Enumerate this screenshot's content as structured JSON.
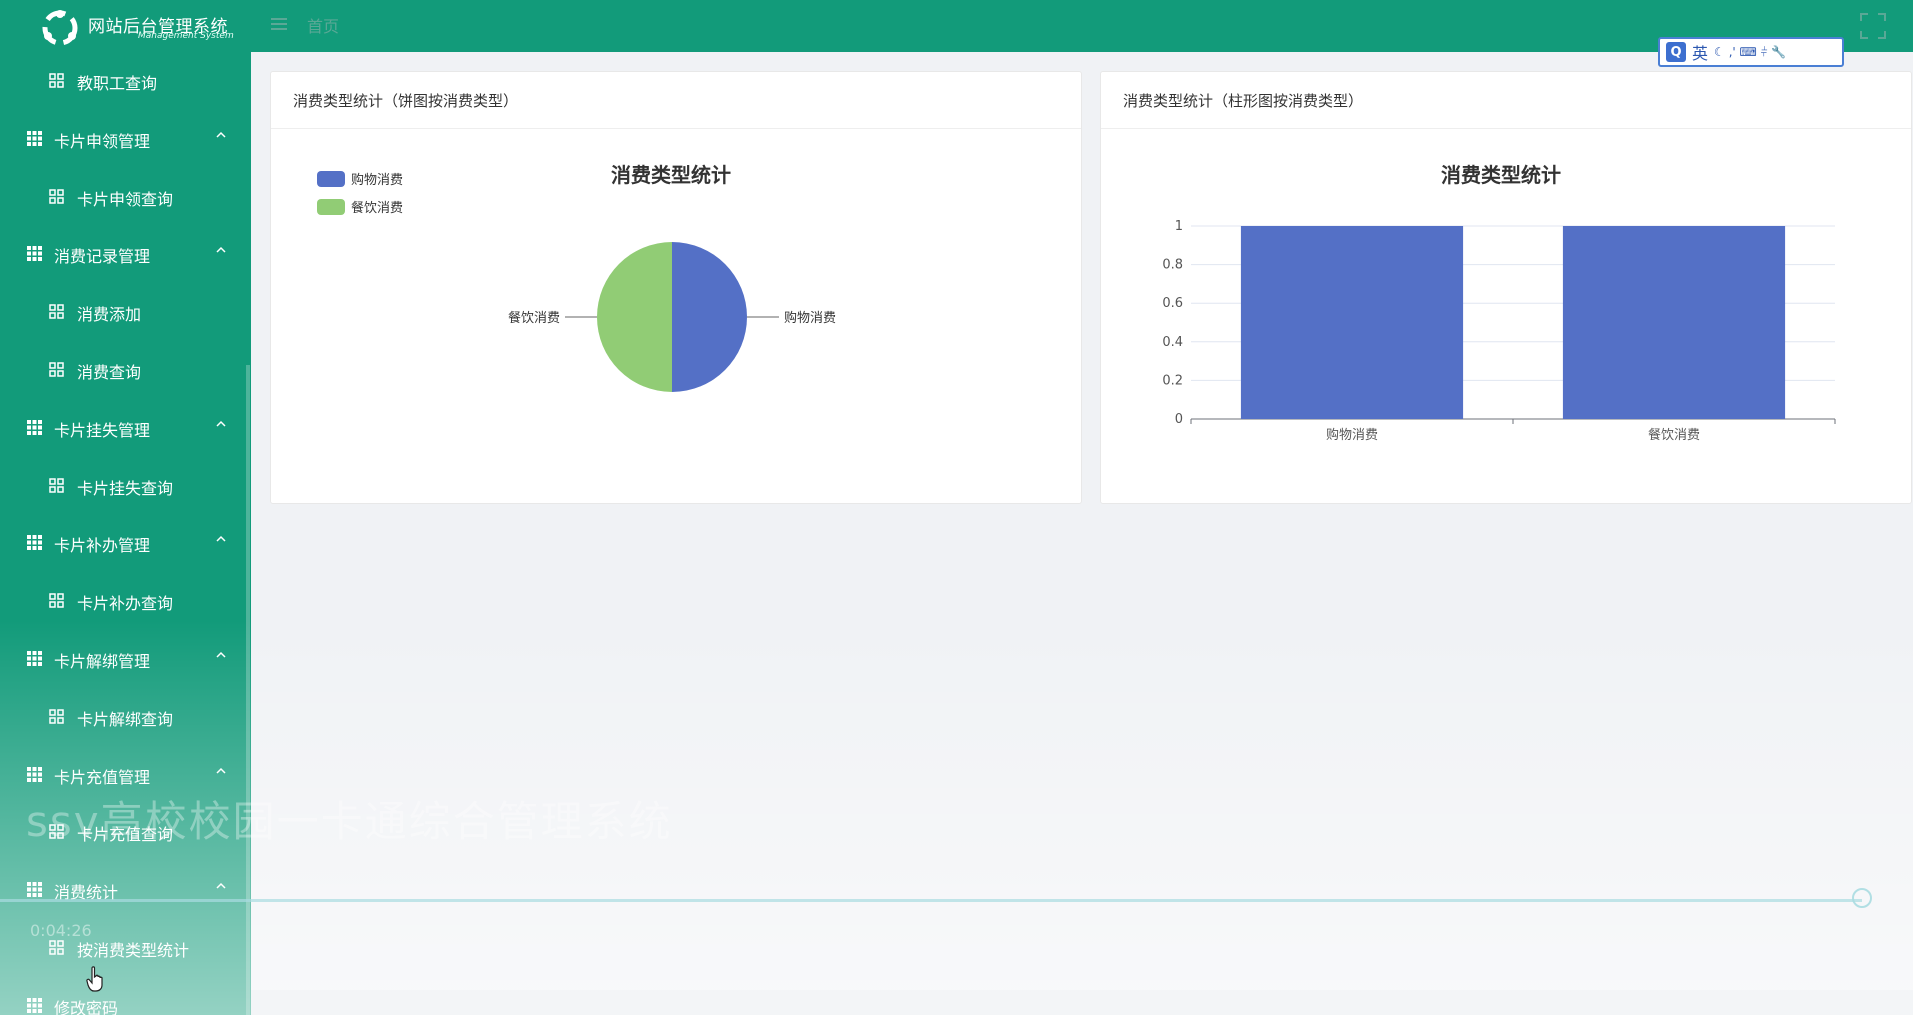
{
  "app": {
    "title": "网站后台管理系统",
    "subtitle": "Management System"
  },
  "header": {
    "home_label": "首页"
  },
  "ime": {
    "q": "Q",
    "lang": "英",
    "symbols": "☾ ‚' ⌨ ⫩ 🔧"
  },
  "sidebar": {
    "items": [
      {
        "type": "sub",
        "label": "教职工查询"
      },
      {
        "type": "group",
        "label": "卡片申领管理"
      },
      {
        "type": "sub",
        "label": "卡片申领查询"
      },
      {
        "type": "group",
        "label": "消费记录管理"
      },
      {
        "type": "sub",
        "label": "消费添加"
      },
      {
        "type": "sub",
        "label": "消费查询"
      },
      {
        "type": "group",
        "label": "卡片挂失管理"
      },
      {
        "type": "sub",
        "label": "卡片挂失查询"
      },
      {
        "type": "group",
        "label": "卡片补办管理"
      },
      {
        "type": "sub",
        "label": "卡片补办查询"
      },
      {
        "type": "group",
        "label": "卡片解绑管理"
      },
      {
        "type": "sub",
        "label": "卡片解绑查询"
      },
      {
        "type": "group",
        "label": "卡片充值管理"
      },
      {
        "type": "sub",
        "label": "卡片充值查询"
      },
      {
        "type": "group",
        "label": "消费统计"
      },
      {
        "type": "sub",
        "label": "按消费类型统计"
      },
      {
        "type": "group",
        "label": "修改密码",
        "no_chevron": true
      }
    ]
  },
  "cards": {
    "pie_card": {
      "header": "消费类型统计（饼图按消费类型）"
    },
    "bar_card": {
      "header": "消费类型统计（柱形图按消费类型）"
    }
  },
  "chart_data": [
    {
      "type": "pie",
      "title": "消费类型统计",
      "legend_position": "top-left",
      "categories": [
        "购物消费",
        "餐饮消费"
      ],
      "values": [
        1,
        1
      ],
      "colors": [
        "#5470c6",
        "#91cc75"
      ]
    },
    {
      "type": "bar",
      "title": "消费类型统计",
      "categories": [
        "购物消费",
        "餐饮消费"
      ],
      "values": [
        1,
        1
      ],
      "ylim": [
        0,
        1
      ],
      "yticks": [
        "0",
        "0.2",
        "0.4",
        "0.6",
        "0.8",
        "1"
      ],
      "grid": true,
      "color": "#5470c6"
    }
  ],
  "overlay": {
    "caption": "ssv高校校园一卡通综合管理系统",
    "timecode": "0:04:26"
  }
}
